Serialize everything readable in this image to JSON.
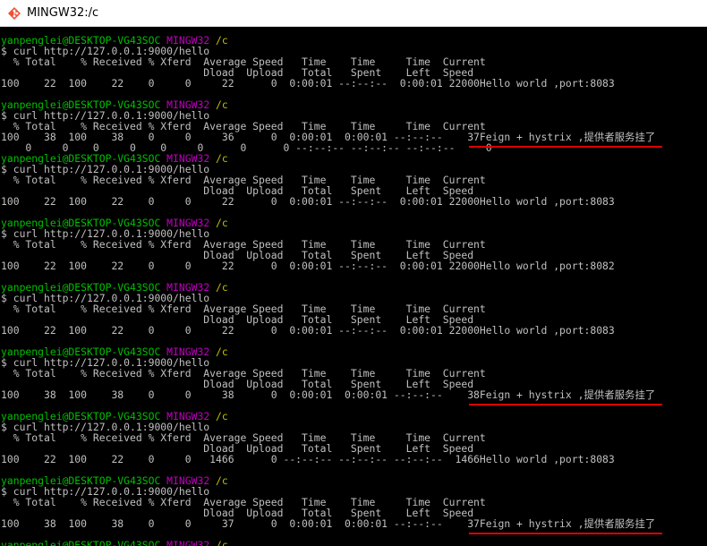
{
  "window": {
    "title": "MINGW32:/c",
    "icon": "git-bash-icon"
  },
  "colors": {
    "user": "#00c000",
    "system": "#c000c0",
    "path": "#c0c000",
    "text": "#c0c0c0",
    "underline": "#e00000",
    "background": "#000000"
  },
  "lines": [
    {
      "type": "prompt",
      "user": "yanpenglei@DESKTOP-VG43SOC",
      "sys": "MINGW32",
      "path": "/c"
    },
    {
      "type": "text",
      "text": "$ curl http://127.0.0.1:9000/hello"
    },
    {
      "type": "text",
      "text": "  % Total    % Received % Xferd  Average Speed   Time    Time     Time  Current"
    },
    {
      "type": "text",
      "text": "                                 Dload  Upload   Total   Spent    Left  Speed"
    },
    {
      "type": "text",
      "text": "100    22  100    22    0     0     22      0  0:00:01 --:--:--  0:00:01 22000Hello world ,port:8083"
    },
    {
      "type": "blank"
    },
    {
      "type": "prompt",
      "user": "yanpenglei@DESKTOP-VG43SOC",
      "sys": "MINGW32",
      "path": "/c"
    },
    {
      "type": "text",
      "text": "$ curl http://127.0.0.1:9000/hello"
    },
    {
      "type": "text",
      "text": "  % Total    % Received % Xferd  Average Speed   Time    Time     Time  Current"
    },
    {
      "type": "text",
      "text": "100    38  100    38    0     0     36      0  0:00:01  0:00:01 --:--:--    37Feign + hystrix ,提供者服务挂了"
    },
    {
      "type": "text",
      "text": "    0     0    0     0    0     0      0      0 --:--:-- --:--:-- --:--:--     0"
    },
    {
      "type": "prompt",
      "user": "yanpenglei@DESKTOP-VG43SOC",
      "sys": "MINGW32",
      "path": "/c"
    },
    {
      "type": "text",
      "text": "$ curl http://127.0.0.1:9000/hello"
    },
    {
      "type": "text",
      "text": "  % Total    % Received % Xferd  Average Speed   Time    Time     Time  Current"
    },
    {
      "type": "text",
      "text": "                                 Dload  Upload   Total   Spent    Left  Speed"
    },
    {
      "type": "text",
      "text": "100    22  100    22    0     0     22      0  0:00:01 --:--:--  0:00:01 22000Hello world ,port:8083"
    },
    {
      "type": "blank"
    },
    {
      "type": "prompt",
      "user": "yanpenglei@DESKTOP-VG43SOC",
      "sys": "MINGW32",
      "path": "/c"
    },
    {
      "type": "text",
      "text": "$ curl http://127.0.0.1:9000/hello"
    },
    {
      "type": "text",
      "text": "  % Total    % Received % Xferd  Average Speed   Time    Time     Time  Current"
    },
    {
      "type": "text",
      "text": "                                 Dload  Upload   Total   Spent    Left  Speed"
    },
    {
      "type": "text",
      "text": "100    22  100    22    0     0     22      0  0:00:01 --:--:--  0:00:01 22000Hello world ,port:8082"
    },
    {
      "type": "blank"
    },
    {
      "type": "prompt",
      "user": "yanpenglei@DESKTOP-VG43SOC",
      "sys": "MINGW32",
      "path": "/c"
    },
    {
      "type": "text",
      "text": "$ curl http://127.0.0.1:9000/hello"
    },
    {
      "type": "text",
      "text": "  % Total    % Received % Xferd  Average Speed   Time    Time     Time  Current"
    },
    {
      "type": "text",
      "text": "                                 Dload  Upload   Total   Spent    Left  Speed"
    },
    {
      "type": "text",
      "text": "100    22  100    22    0     0     22      0  0:00:01 --:--:--  0:00:01 22000Hello world ,port:8083"
    },
    {
      "type": "blank"
    },
    {
      "type": "prompt",
      "user": "yanpenglei@DESKTOP-VG43SOC",
      "sys": "MINGW32",
      "path": "/c"
    },
    {
      "type": "text",
      "text": "$ curl http://127.0.0.1:9000/hello"
    },
    {
      "type": "text",
      "text": "  % Total    % Received % Xferd  Average Speed   Time    Time     Time  Current"
    },
    {
      "type": "text",
      "text": "                                 Dload  Upload   Total   Spent    Left  Speed"
    },
    {
      "type": "text",
      "text": "100    38  100    38    0     0     38      0  0:00:01  0:00:01 --:--:--    38Feign + hystrix ,提供者服务挂了"
    },
    {
      "type": "blank"
    },
    {
      "type": "prompt",
      "user": "yanpenglei@DESKTOP-VG43SOC",
      "sys": "MINGW32",
      "path": "/c"
    },
    {
      "type": "text",
      "text": "$ curl http://127.0.0.1:9000/hello"
    },
    {
      "type": "text",
      "text": "  % Total    % Received % Xferd  Average Speed   Time    Time     Time  Current"
    },
    {
      "type": "text",
      "text": "                                 Dload  Upload   Total   Spent    Left  Speed"
    },
    {
      "type": "text",
      "text": "100    22  100    22    0     0   1466      0 --:--:-- --:--:-- --:--:--  1466Hello world ,port:8083"
    },
    {
      "type": "blank"
    },
    {
      "type": "prompt",
      "user": "yanpenglei@DESKTOP-VG43SOC",
      "sys": "MINGW32",
      "path": "/c"
    },
    {
      "type": "text",
      "text": "$ curl http://127.0.0.1:9000/hello"
    },
    {
      "type": "text",
      "text": "  % Total    % Received % Xferd  Average Speed   Time    Time     Time  Current"
    },
    {
      "type": "text",
      "text": "                                 Dload  Upload   Total   Spent    Left  Speed"
    },
    {
      "type": "text",
      "text": "100    38  100    38    0     0     37      0  0:00:01  0:00:01 --:--:--    37Feign + hystrix ,提供者服务挂了"
    },
    {
      "type": "blank"
    },
    {
      "type": "prompt",
      "user": "yanpenglei@DESKTOP-VG43SOC",
      "sys": "MINGW32",
      "path": "/c"
    }
  ]
}
